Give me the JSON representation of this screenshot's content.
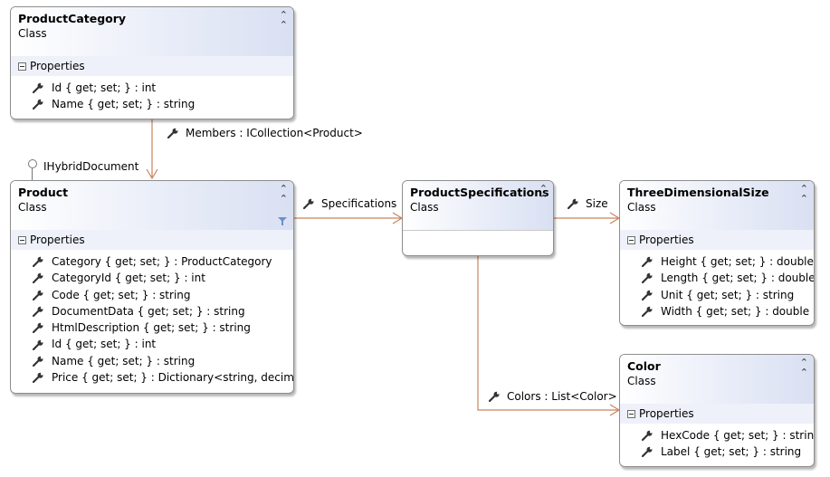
{
  "classes": {
    "product_category": {
      "name": "ProductCategory",
      "kind": "Class",
      "section": "Properties",
      "props": [
        "Id { get; set; } : int",
        "Name { get; set; } : string"
      ]
    },
    "product": {
      "name": "Product",
      "kind": "Class",
      "section": "Properties",
      "props": [
        "Category { get; set; } : ProductCategory",
        "CategoryId { get; set; } : int",
        "Code { get; set; } : string",
        "DocumentData { get; set; } : string",
        "HtmlDescription { get; set; } : string",
        "Id { get; set; } : int",
        "Name { get; set; } : string",
        "Price { get; set; } : Dictionary<string, decimal>"
      ]
    },
    "product_specifications": {
      "name": "ProductSpecifications",
      "kind": "Class"
    },
    "three_dimensional_size": {
      "name": "ThreeDimensionalSize",
      "kind": "Class",
      "section": "Properties",
      "props": [
        "Height { get; set; } : double",
        "Length { get; set; } : double",
        "Unit { get; set; } : string",
        "Width { get; set; } : double"
      ]
    },
    "color": {
      "name": "Color",
      "kind": "Class",
      "section": "Properties",
      "props": [
        "HexCode { get; set; } : string",
        "Label { get; set; } : string"
      ]
    }
  },
  "associations": {
    "members": "Members : ICollection<Product>",
    "specifications": "Specifications",
    "size": "Size",
    "colors": "Colors : List<Color>"
  },
  "interface_label": "IHybridDocument",
  "colors": {
    "connector": "#c8845e",
    "header_gradient_end": "#d9e0f2",
    "section_bg": "#eef1fa",
    "border": "#8e8e8e"
  },
  "icons": {
    "collapse": "double-chevron-up-icon",
    "property": "wrench-icon",
    "section_toggle": "minus-box-icon",
    "filter": "filter-icon",
    "interface": "lollipop-icon"
  }
}
